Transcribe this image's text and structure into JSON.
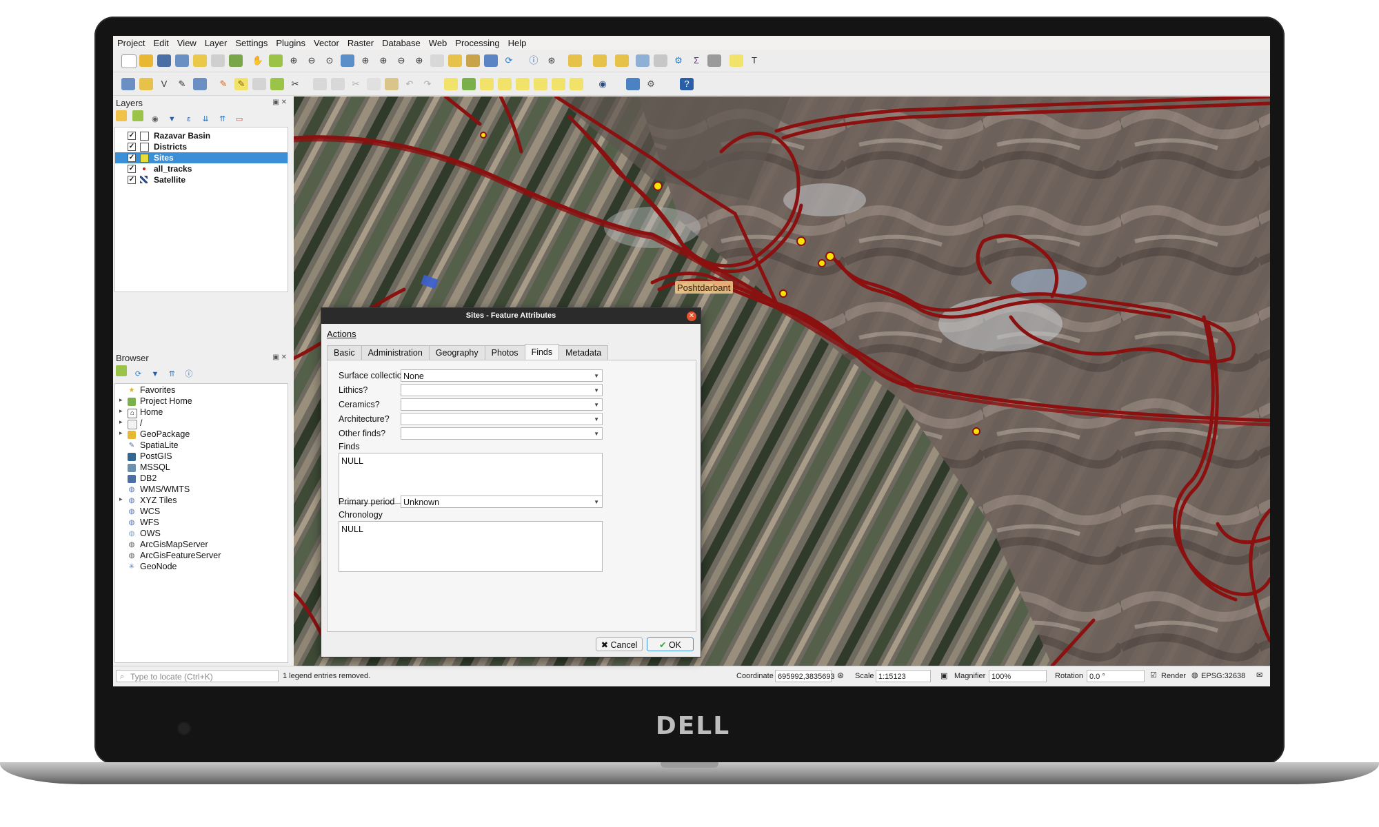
{
  "brand": "DELL",
  "menu": [
    "Project",
    "Edit",
    "View",
    "Layer",
    "Settings",
    "Plugins",
    "Vector",
    "Raster",
    "Database",
    "Web",
    "Processing",
    "Help"
  ],
  "layers_panel": {
    "title": "Layers",
    "items": [
      {
        "label": "Razavar Basin",
        "checked": true,
        "symbol": "polygon-empty"
      },
      {
        "label": "Districts",
        "checked": true,
        "symbol": "polygon-empty"
      },
      {
        "label": "Sites",
        "checked": true,
        "symbol": "polygon-yellow",
        "selected": true
      },
      {
        "label": "all_tracks",
        "checked": true,
        "symbol": "point-red"
      },
      {
        "label": "Satellite",
        "checked": true,
        "symbol": "raster"
      }
    ]
  },
  "browser_panel": {
    "title": "Browser",
    "items": [
      {
        "label": "Favorites",
        "icon": "star-icon",
        "expandable": false
      },
      {
        "label": "Project Home",
        "icon": "project-home-icon",
        "expandable": true
      },
      {
        "label": "Home",
        "icon": "home-icon",
        "expandable": true
      },
      {
        "label": "/",
        "icon": "folder-icon",
        "expandable": true
      },
      {
        "label": "GeoPackage",
        "icon": "geopackage-icon",
        "expandable": true
      },
      {
        "label": "SpatiaLite",
        "icon": "spatialite-icon",
        "expandable": false
      },
      {
        "label": "PostGIS",
        "icon": "postgis-icon",
        "expandable": false
      },
      {
        "label": "MSSQL",
        "icon": "mssql-icon",
        "expandable": false
      },
      {
        "label": "DB2",
        "icon": "db2-icon",
        "expandable": false
      },
      {
        "label": "WMS/WMTS",
        "icon": "wms-icon",
        "expandable": false
      },
      {
        "label": "XYZ Tiles",
        "icon": "xyz-icon",
        "expandable": true
      },
      {
        "label": "WCS",
        "icon": "wcs-icon",
        "expandable": false
      },
      {
        "label": "WFS",
        "icon": "wfs-icon",
        "expandable": false
      },
      {
        "label": "OWS",
        "icon": "ows-icon",
        "expandable": false
      },
      {
        "label": "ArcGisMapServer",
        "icon": "arcgis-map-icon",
        "expandable": false
      },
      {
        "label": "ArcGisFeatureServer",
        "icon": "arcgis-feature-icon",
        "expandable": false
      },
      {
        "label": "GeoNode",
        "icon": "geonode-icon",
        "expandable": false
      }
    ]
  },
  "map": {
    "place_label": "Poshtdarbant",
    "track_color": "#8b1010",
    "site_color": "#f5e400"
  },
  "dialog": {
    "title": "Sites - Feature Attributes",
    "actions_label": "Actions",
    "tabs": [
      "Basic",
      "Administration",
      "Geography",
      "Photos",
      "Finds",
      "Metadata"
    ],
    "active_tab": "Finds",
    "fields": {
      "surface_collection": {
        "label": "Surface collection",
        "value": "None"
      },
      "lithics": {
        "label": "Lithics?",
        "value": ""
      },
      "ceramics": {
        "label": "Ceramics?",
        "value": ""
      },
      "architecture": {
        "label": "Architecture?",
        "value": ""
      },
      "other_finds": {
        "label": "Other finds?",
        "value": ""
      },
      "finds": {
        "label": "Finds",
        "value": "NULL"
      },
      "primary_period": {
        "label": "Primary period",
        "value": "Unknown"
      },
      "chronology": {
        "label": "Chronology",
        "value": "NULL"
      }
    },
    "cancel_label": "Cancel",
    "ok_label": "OK"
  },
  "statusbar": {
    "locate_placeholder": "Type to locate (Ctrl+K)",
    "message": "1 legend entries removed.",
    "coordinate_label": "Coordinate",
    "coordinate_value": "695992,3835693",
    "scale_label": "Scale",
    "scale_value": "1:15123",
    "magnifier_label": "Magnifier",
    "magnifier_value": "100%",
    "rotation_label": "Rotation",
    "rotation_value": "0.0 °",
    "render_label": "Render",
    "render_checked": true,
    "crs_label": "EPSG:32638"
  }
}
